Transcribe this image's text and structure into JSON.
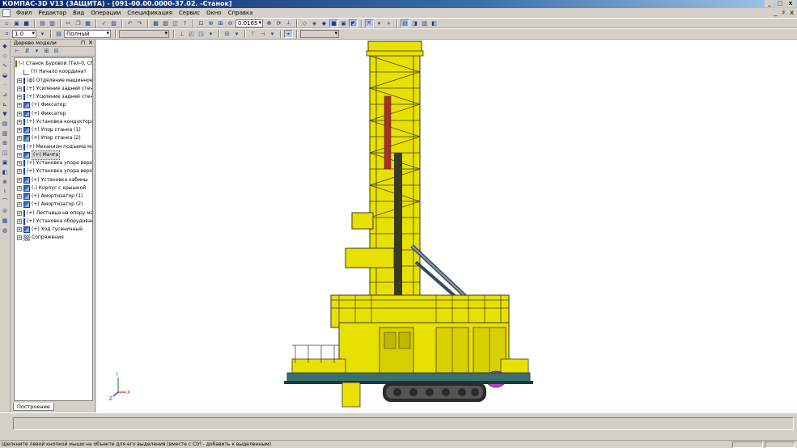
{
  "window": {
    "title": "КОМПАС-3D V13 (ЗАЩИТА) - [091-00.00.0000-37.02. -Станок]",
    "buttons": [
      "_",
      "□",
      "x"
    ]
  },
  "menubar": {
    "items": [
      "Файл",
      "Редактор",
      "Вид",
      "Операции",
      "Спецификация",
      "Сервис",
      "Окно",
      "Справка"
    ],
    "mdi_buttons": [
      "_",
      "♯",
      "x"
    ]
  },
  "toolbar": {
    "zoom_value": "0.0165",
    "scale_value": "1.0",
    "view_mode": "Полный"
  },
  "tree_panel": {
    "title": "Дерево модели",
    "root": "(-) Станок Буровой (Тел-0, Сбо",
    "items": [
      {
        "icon": "origin",
        "label": "(т) Начало координат"
      },
      {
        "icon": "asm",
        "label": "(ф) Отделение машинное"
      },
      {
        "icon": "asm",
        "label": "(+) Усиление задней стенк"
      },
      {
        "icon": "asm",
        "label": "(+) Усиление задней стенк"
      },
      {
        "icon": "asm",
        "label": "(+) Фиксатор"
      },
      {
        "icon": "asm",
        "label": "(+) Фиксатор"
      },
      {
        "icon": "asm",
        "label": "(+) Установка кондуктора"
      },
      {
        "icon": "asm",
        "label": "(+) Упор станка (1)"
      },
      {
        "icon": "asm",
        "label": "(+) Упор станка (2)"
      },
      {
        "icon": "asm",
        "label": "(+) Механизм подъема мач"
      },
      {
        "icon": "asm",
        "label": "(+) Мачта",
        "highlight": true
      },
      {
        "icon": "asm",
        "label": "(+) Установка упора верх"
      },
      {
        "icon": "asm",
        "label": "(+) Установка упора верх"
      },
      {
        "icon": "asm",
        "label": "(+) Установка кабины"
      },
      {
        "icon": "asm",
        "label": "(-) Корпус с крышкой"
      },
      {
        "icon": "asm",
        "label": "(+) Амортизатор (1)"
      },
      {
        "icon": "asm",
        "label": "(+) Амортизатор (2)"
      },
      {
        "icon": "asm",
        "label": "(+) Лестница на опору мач"
      },
      {
        "icon": "asm",
        "label": "(+) Установка оборудован"
      },
      {
        "icon": "asm",
        "label": "(+) Ход гусеничный"
      },
      {
        "icon": "mate",
        "label": "Сопряжения"
      }
    ],
    "tab": "Построение"
  },
  "viewport": {
    "axes": {
      "y": "Y",
      "x": "X",
      "z": "Z"
    },
    "model_colors": {
      "body": "#e8e000",
      "frame": "#3a3a20",
      "track": "#2a2a2a",
      "base": "#3c7070",
      "accent": "#c040c0"
    }
  },
  "statusbar": {
    "text": "Щелкните левой кнопкой мыши на объекте для его выделения (вместе с Ctrl - добавить к выделенным)"
  }
}
